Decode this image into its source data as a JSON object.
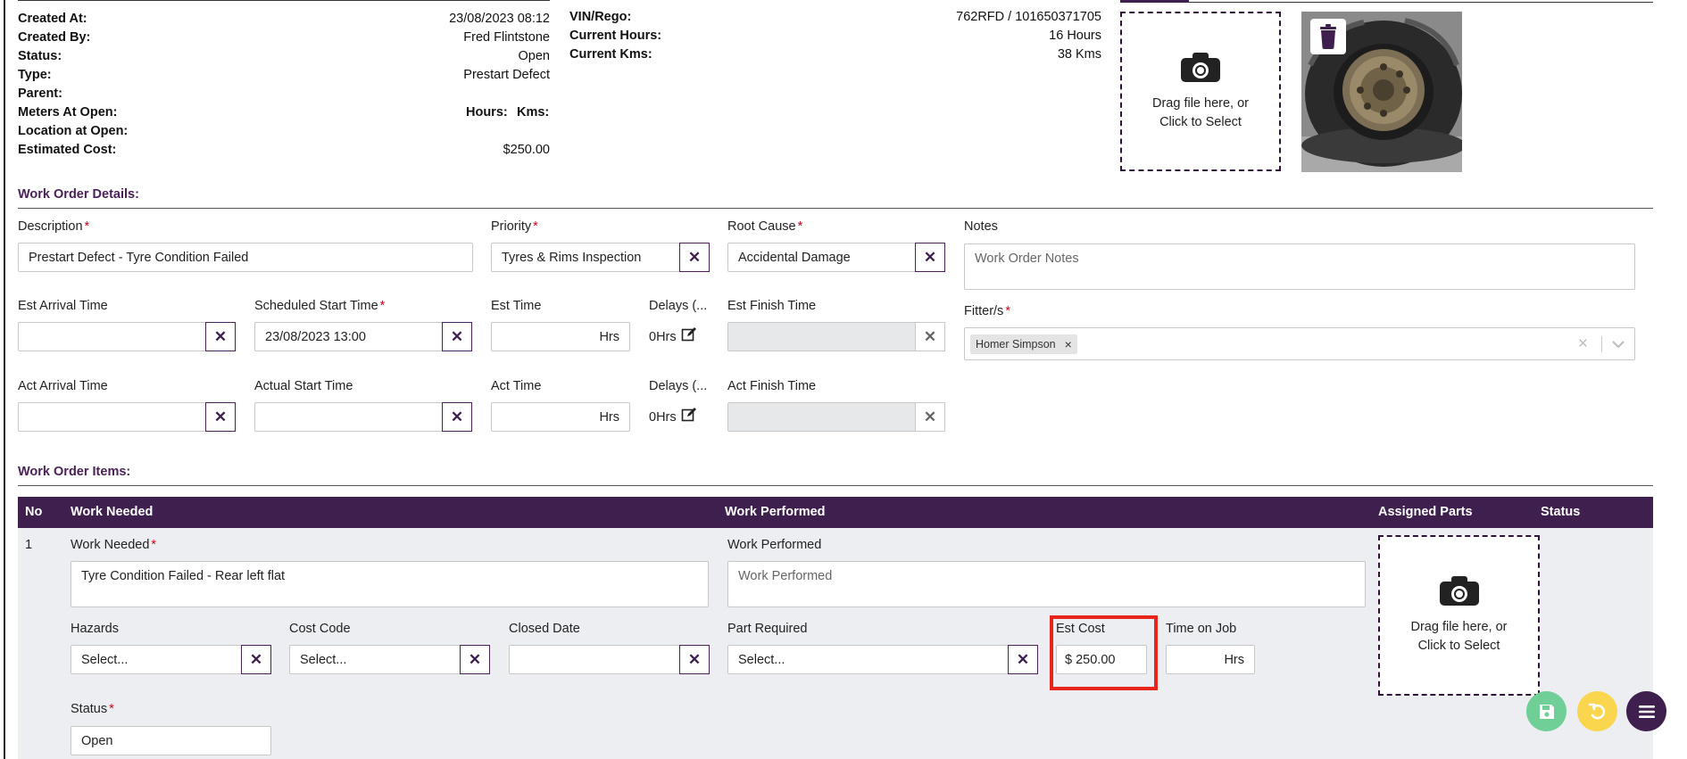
{
  "info_left": {
    "created_at_label": "Created At:",
    "created_at": "23/08/2023 08:12",
    "created_by_label": "Created By:",
    "created_by": "Fred Flintstone",
    "status_label": "Status:",
    "status": "Open",
    "type_label": "Type:",
    "type": "Prestart Defect",
    "parent_label": "Parent:",
    "meters_label": "Meters At Open:",
    "hours_label": "Hours:",
    "kms_label": "Kms:",
    "location_label": "Location at Open:",
    "estimated_cost_label": "Estimated Cost:",
    "estimated_cost": "$250.00"
  },
  "info_right": {
    "vin_label": "VIN/Rego:",
    "vin": "762RFD / 101650371705",
    "hours_label": "Current Hours:",
    "hours": "16 Hours",
    "kms_label": "Current Kms:",
    "kms": "38 Kms"
  },
  "upload": {
    "text1": "Drag file here, or",
    "text2": "Click to Select"
  },
  "details": {
    "title": "Work Order Details:",
    "description_label": "Description",
    "description": "Prestart Defect - Tyre Condition Failed",
    "priority_label": "Priority",
    "priority": "Tyres & Rims Inspection",
    "root_cause_label": "Root Cause",
    "root_cause": "Accidental Damage",
    "notes_label": "Notes",
    "notes_placeholder": "Work Order Notes",
    "est_arrival_label": "Est Arrival Time",
    "sched_start_label": "Scheduled Start Time",
    "sched_start": "23/08/2023 13:00",
    "est_time_label": "Est Time",
    "hrs_suffix": "Hrs",
    "delays_label": "Delays (...",
    "delays_value": "0Hrs",
    "est_finish_label": "Est Finish Time",
    "fitters_label": "Fitter/s",
    "fitter_chip": "Homer Simpson",
    "act_arrival_label": "Act Arrival Time",
    "act_start_label": "Actual Start Time",
    "act_time_label": "Act Time",
    "act_finish_label": "Act Finish Time",
    "x": "✕",
    "chip_x": "×"
  },
  "items": {
    "title": "Work Order Items:",
    "columns": {
      "no": "No",
      "work_needed": "Work Needed",
      "work_performed": "Work Performed",
      "assigned_parts": "Assigned Parts",
      "status": "Status"
    },
    "row": {
      "no": "1",
      "work_needed_label": "Work Needed",
      "work_needed": "Tyre Condition Failed - Rear left flat",
      "work_performed_label": "Work Performed",
      "work_performed_placeholder": "Work Performed",
      "hazards_label": "Hazards",
      "hazards": "Select...",
      "cost_code_label": "Cost Code",
      "cost_code": "Select...",
      "closed_date_label": "Closed Date",
      "part_required_label": "Part Required",
      "part_required": "Select...",
      "est_cost_label": "Est Cost",
      "est_cost": "$ 250.00",
      "time_on_job_label": "Time on Job",
      "hrs_suffix": "Hrs",
      "status_label": "Status",
      "status": "Open"
    }
  },
  "colors": {
    "brand": "#3e1f4d",
    "save_fab": "#6fcf97",
    "undo_fab": "#f9d64e",
    "highlight": "#e8251b"
  }
}
